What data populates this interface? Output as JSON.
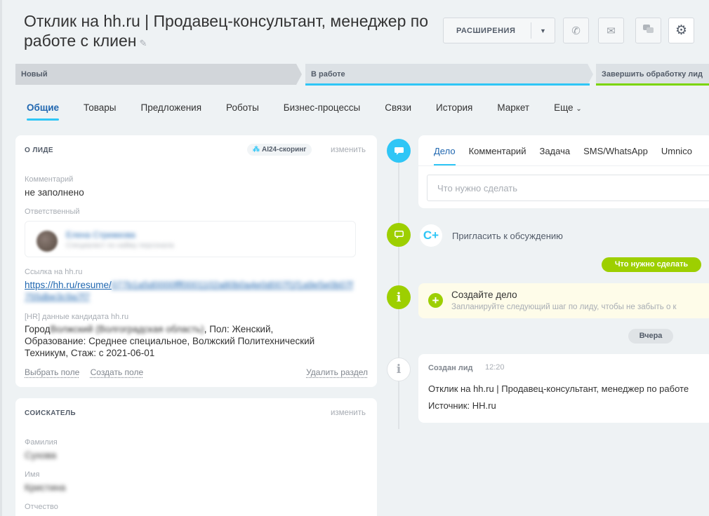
{
  "header": {
    "title": "Отклик на hh.ru | Продавец-консультант, менеджер по работе с клиен",
    "extensions_label": "РАСШИРЕНИЯ",
    "icons": [
      "phone-icon",
      "mail-icon",
      "chat-icon",
      "gear-icon"
    ]
  },
  "stages": [
    {
      "label": "Новый"
    },
    {
      "label": "В работе"
    },
    {
      "label": "Завершить обработку лид"
    }
  ],
  "tabs": [
    "Общие",
    "Товары",
    "Предложения",
    "Роботы",
    "Бизнес-процессы",
    "Связи",
    "История",
    "Маркет",
    "Еще"
  ],
  "about": {
    "heading": "О ЛИДЕ",
    "ai_badge": "AI24-скоринг",
    "change": "изменить",
    "comment_label": "Комментарий",
    "comment_value": "не заполнено",
    "responsible_label": "Ответственный",
    "responsible_name": "Елена Стрижкова",
    "responsible_position": "Специалист по найму персонала",
    "link_label": "Ссылка на hh.ru",
    "link_value": "https://hh.ru/resume/",
    "link_hidden": "077b1a5d0000fff0001102a80b0a4e0d007f1f1a9e5e0b07f755dbe3c9a7f7",
    "hr_label": "[HR] данные кандидата hh.ru",
    "hr_city_prefix": "Город",
    "hr_city_hidden": "Волжский (Волгоградская область)",
    "hr_rest": ", Пол: Женский,",
    "hr_line2": "Образование: Среднее специальное, Волжский Политехнический",
    "hr_line3": "Техникум, Стаж: с 2021-06-01",
    "choose_field": "Выбрать поле",
    "create_field": "Создать поле",
    "delete_section": "Удалить раздел"
  },
  "applicant": {
    "heading": "СОИСКАТЕЛЬ",
    "change": "изменить",
    "surname_label": "Фамилия",
    "surname_value": "Сухова",
    "name_label": "Имя",
    "name_value": "Кристина",
    "patronymic_label": "Отчество"
  },
  "timeline": {
    "editor_tabs": [
      "Дело",
      "Комментарий",
      "Задача",
      "SMS/WhatsApp",
      "Umnico"
    ],
    "input_placeholder": "Что нужно сделать",
    "invite": "Пригласить к обсуждению",
    "todo_button": "Что нужно сделать",
    "todo_title": "Создайте дело",
    "todo_hint": "Запланируйте следующий шаг по лиду, чтобы не забыть о к",
    "yesterday": "Вчера",
    "created_heading": "Создан лид",
    "created_time": "12:20",
    "created_line1": "Отклик на hh.ru | Продавец-консультант, менеджер по работе",
    "created_line2": "Источник: HH.ru"
  },
  "colors": {
    "accent_blue": "#2fc6f6",
    "accent_green": "#9dcf00",
    "link": "#2067b0"
  }
}
